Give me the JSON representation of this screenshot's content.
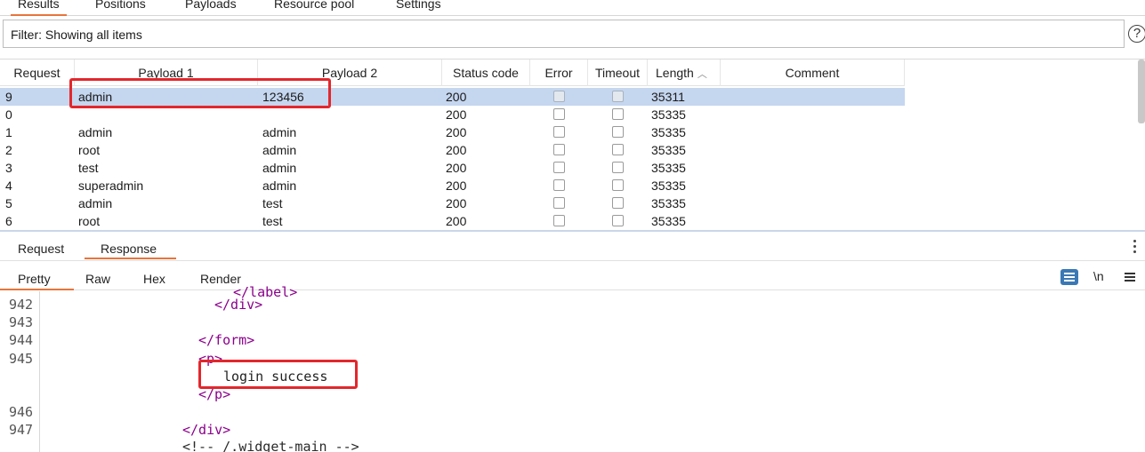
{
  "top_tabs": [
    {
      "label": "Results",
      "active": true
    },
    {
      "label": "Positions",
      "active": false
    },
    {
      "label": "Payloads",
      "active": false
    },
    {
      "label": "Resource pool",
      "active": false
    },
    {
      "label": "Settings",
      "active": false
    }
  ],
  "filter": {
    "text": "Filter: Showing all items",
    "help_icon": "help-icon"
  },
  "table": {
    "headers": [
      "Request",
      "Payload 1",
      "Payload 2",
      "Status code",
      "Error",
      "Timeout",
      "Length",
      "Comment"
    ],
    "sort_column": "Length",
    "sort_direction": "ascending",
    "rows": [
      {
        "request": "9",
        "payload1": "admin",
        "payload2": "123456",
        "status": "200",
        "error": false,
        "timeout": false,
        "length": "35311",
        "comment": "",
        "selected": true
      },
      {
        "request": "0",
        "payload1": "",
        "payload2": "",
        "status": "200",
        "error": false,
        "timeout": false,
        "length": "35335",
        "comment": "",
        "selected": false
      },
      {
        "request": "1",
        "payload1": "admin",
        "payload2": "admin",
        "status": "200",
        "error": false,
        "timeout": false,
        "length": "35335",
        "comment": "",
        "selected": false
      },
      {
        "request": "2",
        "payload1": "root",
        "payload2": "admin",
        "status": "200",
        "error": false,
        "timeout": false,
        "length": "35335",
        "comment": "",
        "selected": false
      },
      {
        "request": "3",
        "payload1": "test",
        "payload2": "admin",
        "status": "200",
        "error": false,
        "timeout": false,
        "length": "35335",
        "comment": "",
        "selected": false
      },
      {
        "request": "4",
        "payload1": "superadmin",
        "payload2": "admin",
        "status": "200",
        "error": false,
        "timeout": false,
        "length": "35335",
        "comment": "",
        "selected": false
      },
      {
        "request": "5",
        "payload1": "admin",
        "payload2": "test",
        "status": "200",
        "error": false,
        "timeout": false,
        "length": "35335",
        "comment": "",
        "selected": false
      },
      {
        "request": "6",
        "payload1": "root",
        "payload2": "test",
        "status": "200",
        "error": false,
        "timeout": false,
        "length": "35335",
        "comment": "",
        "selected": false
      }
    ]
  },
  "message_tabs": [
    {
      "label": "Request",
      "active": false
    },
    {
      "label": "Response",
      "active": true
    }
  ],
  "view_tabs": [
    {
      "label": "Pretty",
      "active": true
    },
    {
      "label": "Raw",
      "active": false
    },
    {
      "label": "Hex",
      "active": false
    },
    {
      "label": "Render",
      "active": false
    }
  ],
  "toolbar": {
    "newline_label": "\\n",
    "wrap_icon": "word-wrap-icon",
    "menu_icon": "hamburger-menu-icon",
    "more_icon": "kebab-menu-icon"
  },
  "code": {
    "line_numbers": [
      "942",
      "943",
      "944",
      "945",
      "946",
      "947"
    ],
    "line_942_tag": "</div>",
    "line_944_tag": "</form>",
    "line_945_open": "<p>",
    "line_945_text": "login success",
    "line_945_close": "</p>",
    "line_947_tag": "</div>",
    "line_948_comment": "<!-- /.widget-main -->"
  },
  "colors": {
    "accent": "#e8743b",
    "selection": "#c5d6ef",
    "highlight_box": "#e3272c",
    "tag": "#8b008b",
    "wrap_button": "#3a78b5"
  }
}
